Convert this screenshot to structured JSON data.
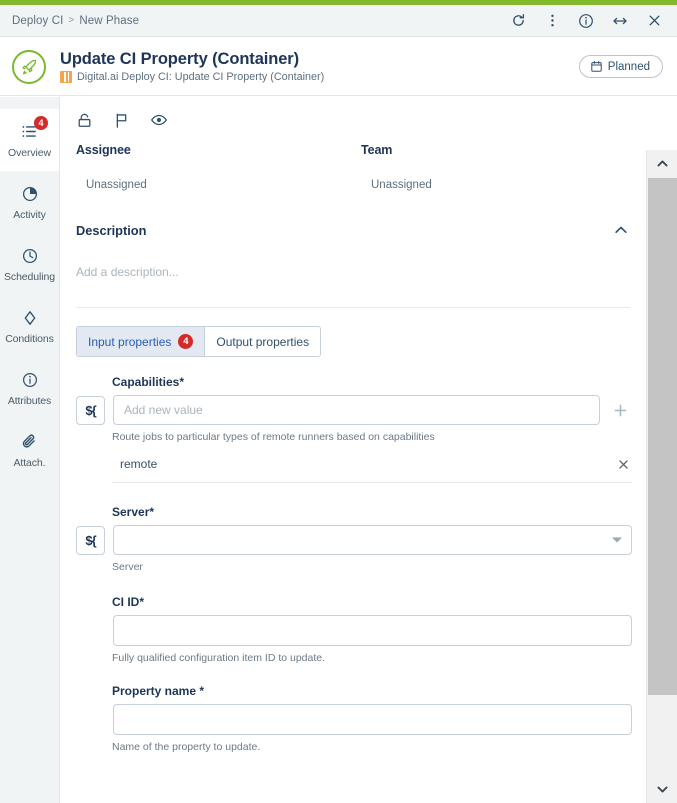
{
  "window": {
    "breadcrumb": {
      "root": "Deploy CI",
      "separator": ">",
      "current": "New Phase"
    },
    "actions": [
      {
        "name": "refresh-button",
        "label": "Refresh"
      },
      {
        "name": "more-options-button",
        "label": "More options"
      },
      {
        "name": "info-button",
        "label": "Info"
      },
      {
        "name": "expand-button",
        "label": "Expand"
      },
      {
        "name": "close-button",
        "label": "Close"
      }
    ]
  },
  "header": {
    "logo_icon": "rocket-icon",
    "title": "Update CI Property (Container)",
    "subtitle": "Digital.ai Deploy CI: Update CI Property (Container)",
    "subtitle_icon": "container-task-icon",
    "status": {
      "label": "Planned",
      "icon": "calendar-icon"
    },
    "accent_color": "#7cb82f"
  },
  "sidebar": {
    "items": [
      {
        "label": "Overview",
        "icon": "list-icon",
        "badge": "4",
        "active": true
      },
      {
        "label": "Activity",
        "icon": "pie-chart-icon",
        "badge": "",
        "active": false
      },
      {
        "label": "Scheduling",
        "icon": "clock-icon",
        "badge": "",
        "active": false
      },
      {
        "label": "Conditions",
        "icon": "diamond-icon",
        "badge": "",
        "active": false
      },
      {
        "label": "Attributes",
        "icon": "info-icon",
        "badge": "",
        "active": false
      },
      {
        "label": "Attach.",
        "icon": "paperclip-icon",
        "badge": "",
        "active": false
      }
    ]
  },
  "toolbar": {
    "icons": [
      {
        "name": "unlock-icon",
        "label": "Lock"
      },
      {
        "name": "flag-icon",
        "label": "Flag"
      },
      {
        "name": "eye-icon",
        "label": "Watch"
      }
    ]
  },
  "overview": {
    "assignee_label": "Assignee",
    "assignee_value": "Unassigned",
    "team_label": "Team",
    "team_value": "Unassigned",
    "description_label": "Description",
    "description_placeholder": "Add a description..."
  },
  "tabs": [
    {
      "label": "Input properties",
      "badge": "4",
      "active": true
    },
    {
      "label": "Output properties",
      "badge": "",
      "active": false
    }
  ],
  "form": {
    "fields": [
      {
        "label": "Capabilities",
        "required": "*",
        "expression_btn": "${",
        "placeholder": "Add new value",
        "value": "",
        "help": "Route jobs to particular types of remote runners based on capabilities",
        "add_icon": "plus-icon",
        "values": [
          {
            "text": "remote",
            "remove_icon": "close-icon"
          }
        ]
      },
      {
        "label": "Server",
        "required": "*",
        "expression_btn": "${",
        "placeholder": "",
        "value": "",
        "help": "Server",
        "dropdown_icon": "chevron-down-icon"
      },
      {
        "label": "CI ID",
        "required": "*",
        "placeholder": "",
        "value": "",
        "help": "Fully qualified configuration item ID to update."
      },
      {
        "label": "Property name",
        "required": "*",
        "placeholder": "",
        "value": "",
        "help": "Name of the property to update."
      }
    ]
  },
  "scrollbar": {
    "up_icon": "chevron-up-icon",
    "down_icon": "chevron-down-icon"
  }
}
